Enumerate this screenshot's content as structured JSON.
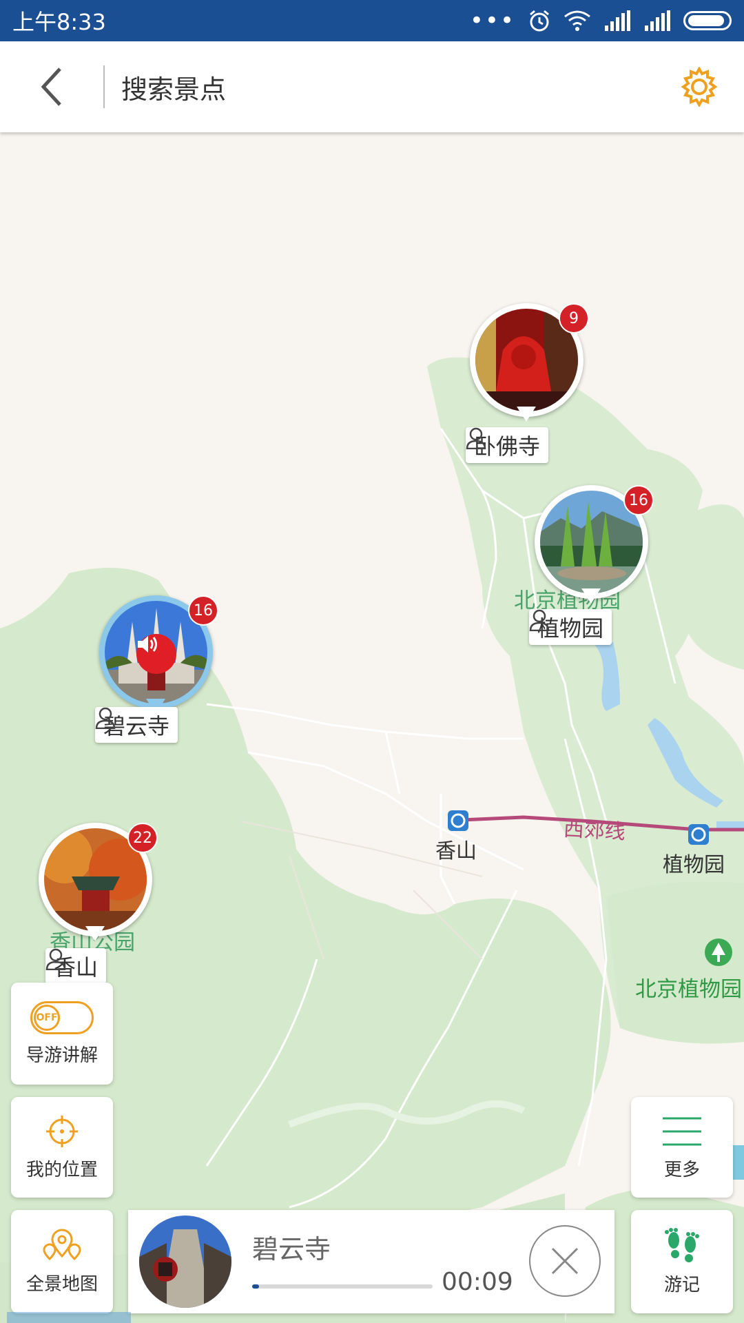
{
  "status_bar": {
    "time": "上午8:33"
  },
  "header": {
    "title": "搜索景点"
  },
  "map": {
    "labels": {
      "xiangshan_station": "香山",
      "botanical_station": "植物园",
      "line_name": "西郊线",
      "beijing_botanical": "北京植物园",
      "beijing_botanical_right": "北京植物园",
      "xiangshan_park": "香山公园"
    }
  },
  "pois": [
    {
      "name": "卧佛寺",
      "count": "9"
    },
    {
      "name": "植物园",
      "count": "16"
    },
    {
      "name": "碧云寺",
      "count": "16"
    },
    {
      "name": "香山",
      "count": "22"
    }
  ],
  "controls": {
    "guide_toggle_state": "OFF",
    "guide_label": "导游讲解",
    "location_label": "我的位置",
    "panorama_label": "全景地图",
    "more_label": "更多",
    "travel_label": "游记"
  },
  "player": {
    "title": "碧云寺",
    "time": "00:09",
    "progress": 0.04
  },
  "colors": {
    "accent": "#f0a020",
    "brand": "#1b4f93",
    "badge": "#d42127",
    "travel_green": "#2aa86a"
  }
}
